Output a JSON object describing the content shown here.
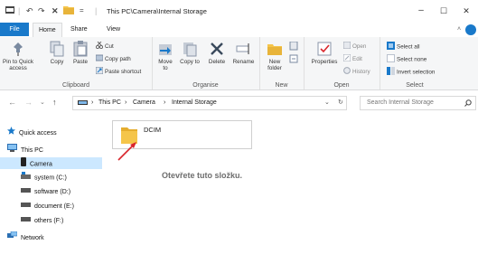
{
  "window": {
    "title": "This PC\\Camera\\Internal Storage",
    "minimize": "–",
    "maximize": "☐",
    "close": "✕",
    "ribbon_toggle": "˄"
  },
  "quick_access_toolbar": {
    "undo": "↶",
    "redo": "↷",
    "delete": "✕",
    "divider": "="
  },
  "ribbon_tabs": [
    "File",
    "Home",
    "Share",
    "View"
  ],
  "ribbon": {
    "clipboard": {
      "label": "Clipboard",
      "pin": "Pin to Quick access",
      "copy": "Copy",
      "paste": "Paste",
      "cut": "Cut",
      "copy_path": "Copy path",
      "paste_shortcut": "Paste shortcut"
    },
    "organise": {
      "label": "Organise",
      "move_to": "Move to",
      "copy_to": "Copy to",
      "delete": "Delete",
      "rename": "Rename"
    },
    "new": {
      "label": "New",
      "new_folder": "New folder"
    },
    "open": {
      "label": "Open",
      "properties": "Properties",
      "open": "Open",
      "edit": "Edit",
      "history": "History"
    },
    "select": {
      "label": "Select",
      "select_all": "Select all",
      "select_none": "Select none",
      "invert_selection": "Invert selection"
    }
  },
  "address_bar": {
    "back": "←",
    "forward": "→",
    "recent": "⌄",
    "up": "↑",
    "crumbs": [
      "This PC",
      "Camera",
      "Internal Storage"
    ],
    "separator": "›",
    "dropdown": "⌄",
    "refresh": "↻"
  },
  "search": {
    "placeholder": "Search Internal Storage"
  },
  "nav_pane": {
    "quick_access": "Quick access",
    "this_pc": "This PC",
    "camera": "Camera",
    "drives": [
      "system (C:)",
      "software (D:)",
      "document (E:)",
      "others (F:)"
    ],
    "network": "Network"
  },
  "content": {
    "folder_name": "DCIM",
    "hint": "Otevřete tuto složku."
  },
  "colors": {
    "accent": "#1979ca",
    "selection": "#cce8ff",
    "folder": "#f5c54a",
    "arrow": "#d9252b"
  }
}
